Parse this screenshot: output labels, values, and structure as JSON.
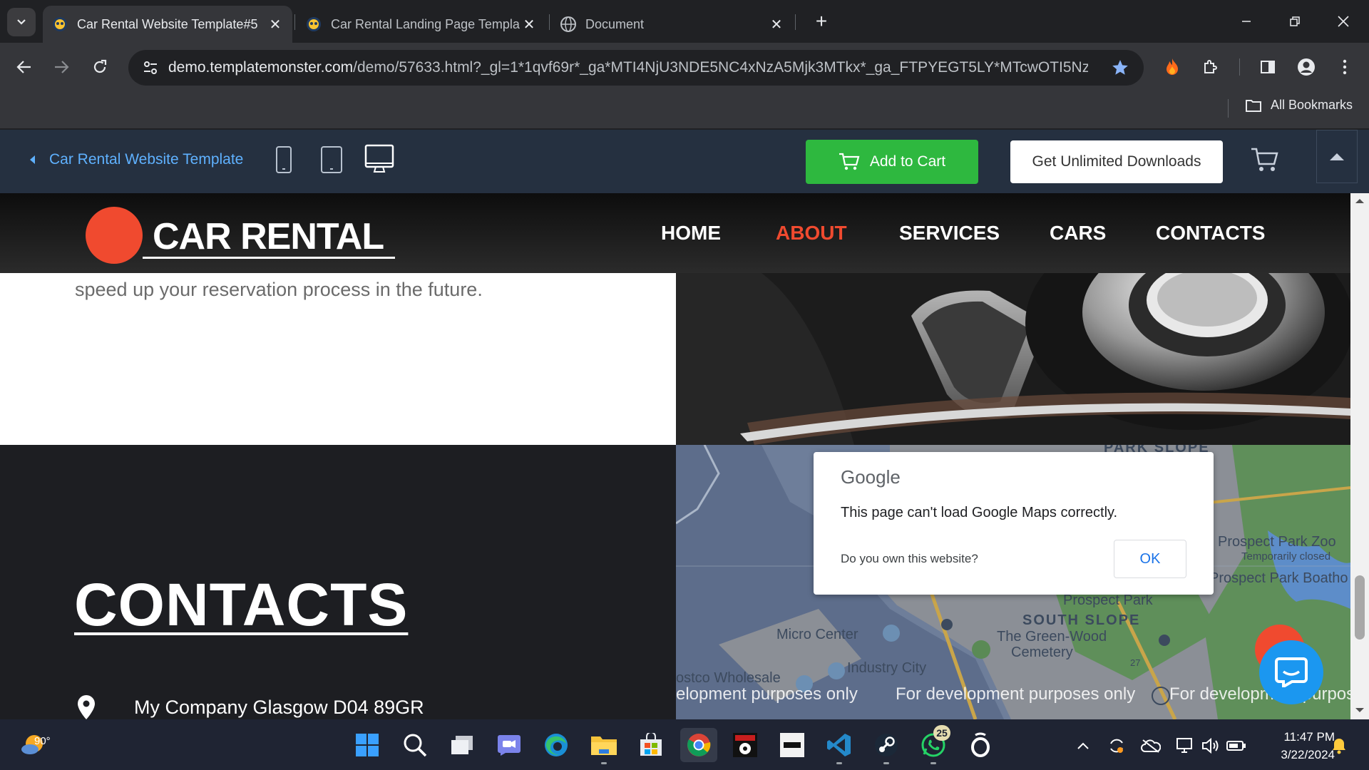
{
  "browser": {
    "tabs": [
      {
        "title": "Car Rental Website Template#5",
        "active": true
      },
      {
        "title": "Car Rental Landing Page Templa",
        "active": false
      },
      {
        "title": "Document",
        "active": false
      }
    ],
    "address": {
      "host": "demo.templatemonster.com",
      "path": "/demo/57633.html?_gl=1*1qvf69r*_ga*MTI4NjU3NDE5NC4xNzA5Mjk3MTkx*_ga_FTPYEGT5LY*MTcwOTI5NzE5..."
    },
    "bookmarks": {
      "all_bookmarks_label": "All Bookmarks"
    }
  },
  "demo_bar": {
    "back_label": "Car Rental Website Template",
    "add_to_cart_label": "Add to Cart",
    "unlimited_label": "Get Unlimited Downloads"
  },
  "site": {
    "logo_text": "CAR RENTAL",
    "nav": [
      {
        "label": "HOME",
        "active": false
      },
      {
        "label": "ABOUT",
        "active": true
      },
      {
        "label": "SERVICES",
        "active": false
      },
      {
        "label": "CARS",
        "active": false
      },
      {
        "label": "CONTACTS",
        "active": false
      }
    ],
    "paragraph_tail": "speed up your reservation process in the future.",
    "contacts_heading": "CONTACTS",
    "address": "My Company Glasgow D04 89GR",
    "accent_color": "#f04a2f"
  },
  "map": {
    "labels": {
      "park_slope": "PARK SLOPE",
      "prospect_park_zoo": "Prospect Park Zoo",
      "temporarily_closed": "Temporarily closed",
      "prospect_park_boathouse": "Prospect Park Boatho",
      "prospect_park": "Prospect Park",
      "south_slope": "SOUTH SLOPE",
      "micro_center": "Micro Center",
      "green_wood": "The Green-Wood",
      "cemetery": "Cemetery",
      "industry_city": "Industry City",
      "costco": "ostco Wholesale",
      "route": "27",
      "dev_1": "elopment purposes only",
      "dev_2": "For development purposes only",
      "dev_3": "For development purpose"
    },
    "dialog": {
      "brand": "Google",
      "message": "This page can't load Google Maps correctly.",
      "own_site": "Do you own this website?",
      "ok_label": "OK"
    }
  },
  "taskbar": {
    "weather_temp": "90°",
    "whatsapp_badge": "25",
    "time": "11:47 PM",
    "date": "3/22/2024"
  }
}
